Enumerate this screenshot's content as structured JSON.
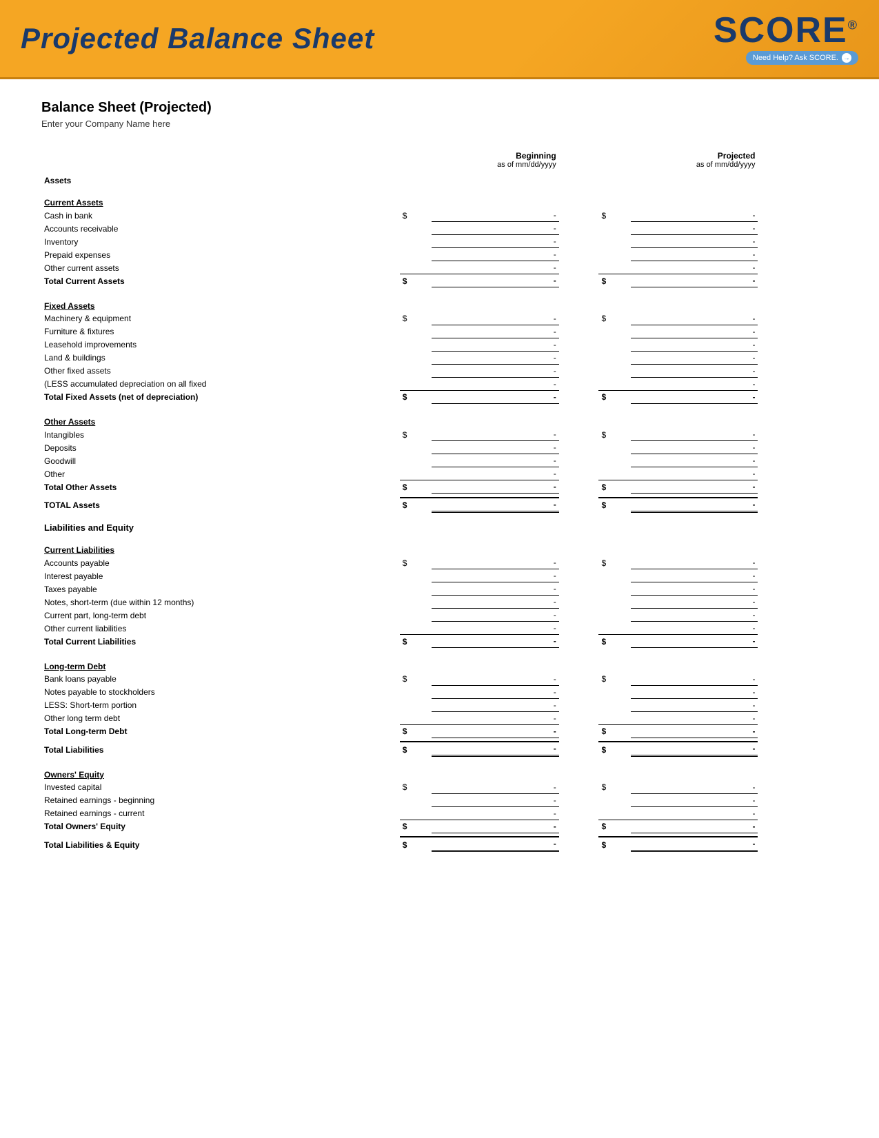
{
  "header": {
    "title": "Projected Balance Sheet",
    "score_text": "SCORE",
    "score_registered": "®",
    "tagline": "Need Help? Ask SCORE.",
    "tagline_arrow": "→"
  },
  "document": {
    "title": "Balance Sheet (Projected)",
    "company_placeholder": "Enter your Company Name here"
  },
  "columns": {
    "beginning_label": "Beginning",
    "beginning_date": "as of mm/dd/yyyy",
    "projected_label": "Projected",
    "projected_date": "as of mm/dd/yyyy"
  },
  "sections": {
    "assets_label": "Assets",
    "current_assets": {
      "heading": "Current Assets",
      "items": [
        {
          "label": "Cash in bank",
          "show_dollar": true,
          "beg": "-",
          "proj": "-"
        },
        {
          "label": "Accounts receivable",
          "show_dollar": false,
          "beg": "-",
          "proj": "-"
        },
        {
          "label": "Inventory",
          "show_dollar": false,
          "beg": "-",
          "proj": "-"
        },
        {
          "label": "Prepaid expenses",
          "show_dollar": false,
          "beg": "-",
          "proj": "-"
        },
        {
          "label": "Other current assets",
          "show_dollar": false,
          "beg": "-",
          "proj": "-"
        }
      ],
      "total_label": "Total Current Assets",
      "total_beg": "-",
      "total_proj": "-"
    },
    "fixed_assets": {
      "heading": "Fixed Assets",
      "items": [
        {
          "label": "Machinery & equipment",
          "show_dollar": true,
          "beg": "-",
          "proj": "-"
        },
        {
          "label": "Furniture & fixtures",
          "show_dollar": false,
          "beg": "-",
          "proj": "-"
        },
        {
          "label": "Leasehold improvements",
          "show_dollar": false,
          "beg": "-",
          "proj": "-"
        },
        {
          "label": "Land & buildings",
          "show_dollar": false,
          "beg": "-",
          "proj": "-"
        },
        {
          "label": "Other fixed assets",
          "show_dollar": false,
          "beg": "-",
          "proj": "-"
        },
        {
          "label": "(LESS accumulated depreciation on all fixed",
          "show_dollar": false,
          "beg": "-",
          "proj": "-"
        }
      ],
      "total_label": "Total Fixed Assets (net of depreciation)",
      "total_beg": "-",
      "total_proj": "-"
    },
    "other_assets": {
      "heading": "Other Assets",
      "items": [
        {
          "label": "Intangibles",
          "show_dollar": true,
          "beg": "-",
          "proj": "-"
        },
        {
          "label": "Deposits",
          "show_dollar": false,
          "beg": "-",
          "proj": "-"
        },
        {
          "label": "Goodwill",
          "show_dollar": false,
          "beg": "-",
          "proj": "-"
        },
        {
          "label": "Other",
          "show_dollar": false,
          "beg": "-",
          "proj": "-"
        }
      ],
      "total_label": "Total Other Assets",
      "total_beg": "-",
      "total_proj": "-"
    },
    "total_assets": {
      "label": "TOTAL Assets",
      "beg": "-",
      "proj": "-"
    },
    "liabilities_equity_label": "Liabilities and Equity",
    "current_liabilities": {
      "heading": "Current Liabilities",
      "items": [
        {
          "label": "Accounts payable",
          "show_dollar": true,
          "beg": "-",
          "proj": "-"
        },
        {
          "label": "Interest payable",
          "show_dollar": false,
          "beg": "-",
          "proj": "-"
        },
        {
          "label": "Taxes payable",
          "show_dollar": false,
          "beg": "-",
          "proj": "-"
        },
        {
          "label": "Notes, short-term (due within 12 months)",
          "show_dollar": false,
          "beg": "-",
          "proj": "-"
        },
        {
          "label": "Current part, long-term debt",
          "show_dollar": false,
          "beg": "-",
          "proj": "-"
        },
        {
          "label": "Other current liabilities",
          "show_dollar": false,
          "beg": "-",
          "proj": "-"
        }
      ],
      "total_label": "Total Current Liabilities",
      "total_beg": "-",
      "total_proj": "-"
    },
    "longterm_debt": {
      "heading": "Long-term Debt",
      "items": [
        {
          "label": "Bank loans payable",
          "show_dollar": true,
          "beg": "-",
          "proj": "-"
        },
        {
          "label": "Notes payable to stockholders",
          "show_dollar": false,
          "beg": "-",
          "proj": "-"
        },
        {
          "label": "LESS: Short-term portion",
          "show_dollar": false,
          "beg": "-",
          "proj": "-"
        },
        {
          "label": "Other long term debt",
          "show_dollar": false,
          "beg": "-",
          "proj": "-"
        }
      ],
      "total_label": "Total Long-term Debt",
      "total_beg": "-",
      "total_proj": "-"
    },
    "total_liabilities": {
      "label": "Total Liabilities",
      "beg": "-",
      "proj": "-"
    },
    "owners_equity": {
      "heading": "Owners' Equity",
      "items": [
        {
          "label": "Invested capital",
          "show_dollar": true,
          "beg": "-",
          "proj": "-"
        },
        {
          "label": "Retained earnings - beginning",
          "show_dollar": false,
          "beg": "-",
          "proj": "-"
        },
        {
          "label": "Retained earnings - current",
          "show_dollar": false,
          "beg": "-",
          "proj": "-"
        }
      ],
      "total_label": "Total Owners' Equity",
      "total_beg": "-",
      "total_proj": "-"
    },
    "total_liabilities_equity": {
      "label": "Total Liabilities & Equity",
      "beg": "-",
      "proj": "-"
    }
  }
}
